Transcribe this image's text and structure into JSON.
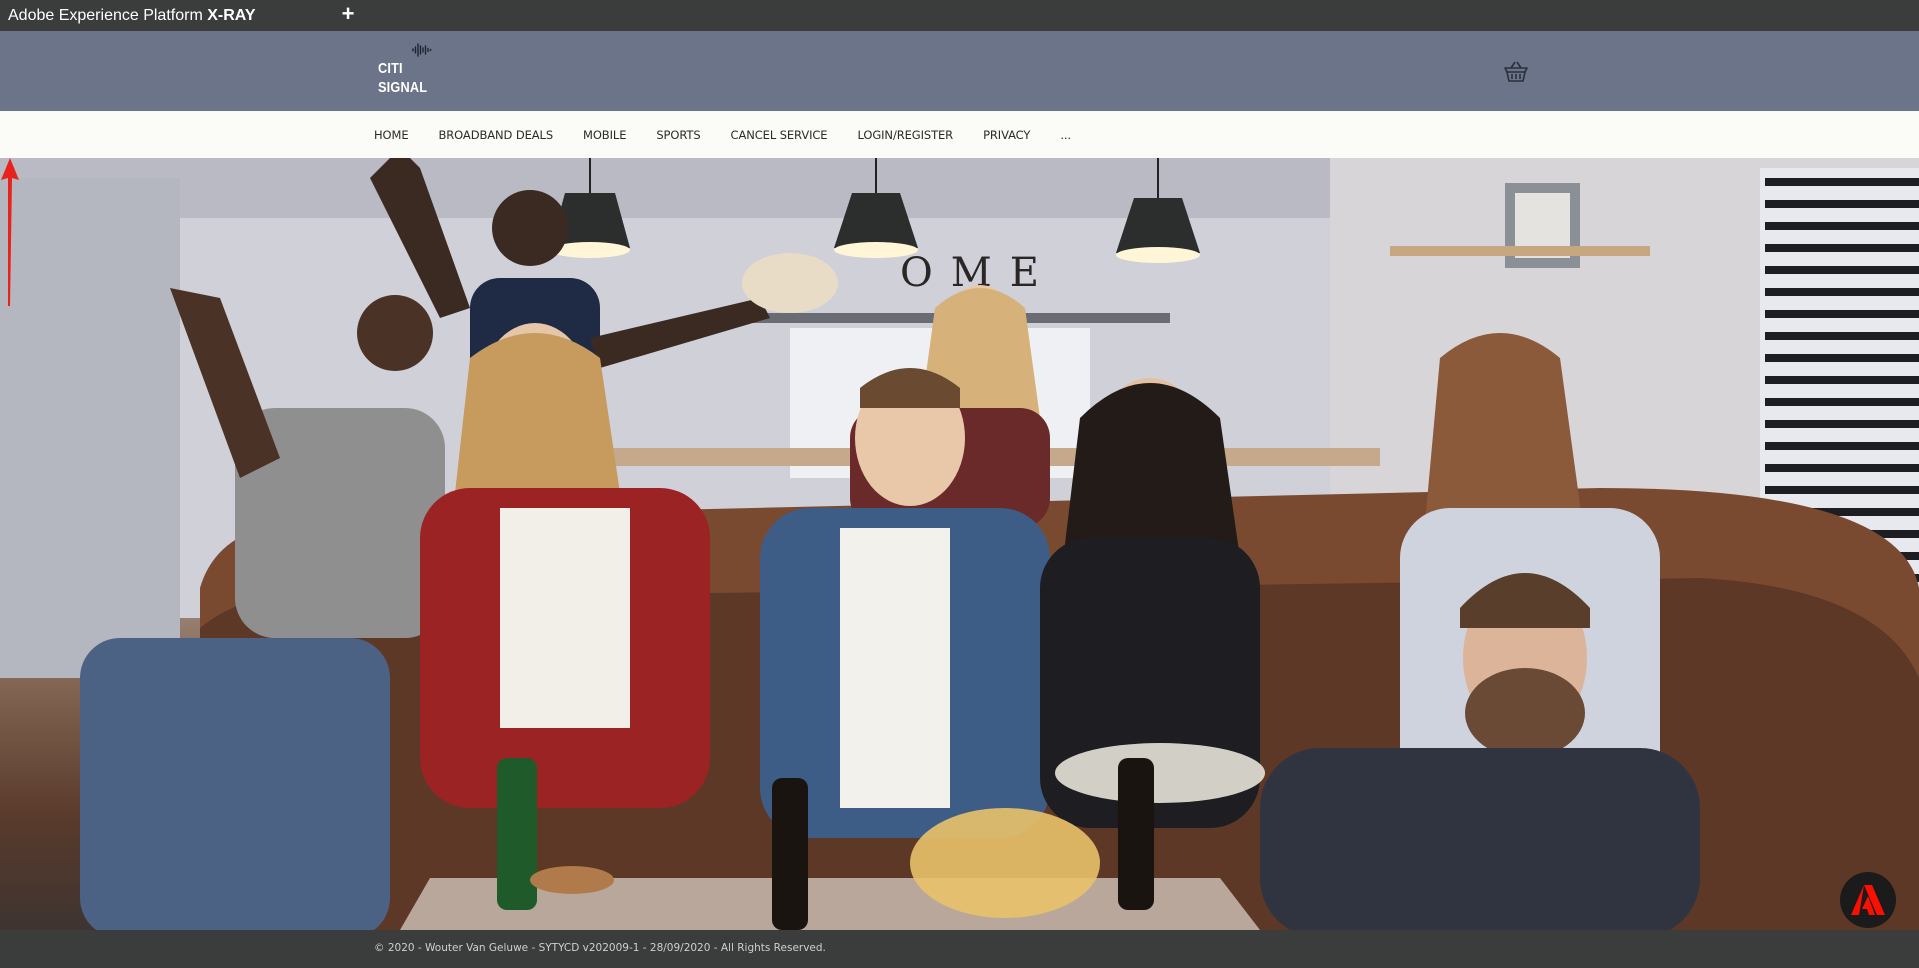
{
  "appbar": {
    "title_prefix": "Adobe Experience Platform",
    "title_bold": "X-RAY",
    "new_tab_symbol": "+"
  },
  "header": {
    "logo_line1": "CITI",
    "logo_line2": "SIGNAL",
    "cart_icon": "basket-icon"
  },
  "nav": {
    "items": [
      {
        "label": "HOME"
      },
      {
        "label": "BROADBAND DEALS"
      },
      {
        "label": "MOBILE"
      },
      {
        "label": "SPORTS"
      },
      {
        "label": "CANCEL SERVICE"
      },
      {
        "label": "LOGIN/REGISTER"
      },
      {
        "label": "PRIVACY"
      },
      {
        "label": "..."
      }
    ]
  },
  "hero": {
    "wall_letters": "OME",
    "annotation_color": "#e8231c"
  },
  "footer": {
    "copyright": "© 2020 - Wouter Van Geluwe - SYTYCD v202009-1 - 28/09/2020 - All Rights Reserved."
  },
  "colors": {
    "appbar": "#3a3d3c",
    "header": "#6b7488",
    "nav_bg": "#fbfbf8",
    "footer": "#3a3d3c",
    "adobe_red": "#fa0f00"
  }
}
